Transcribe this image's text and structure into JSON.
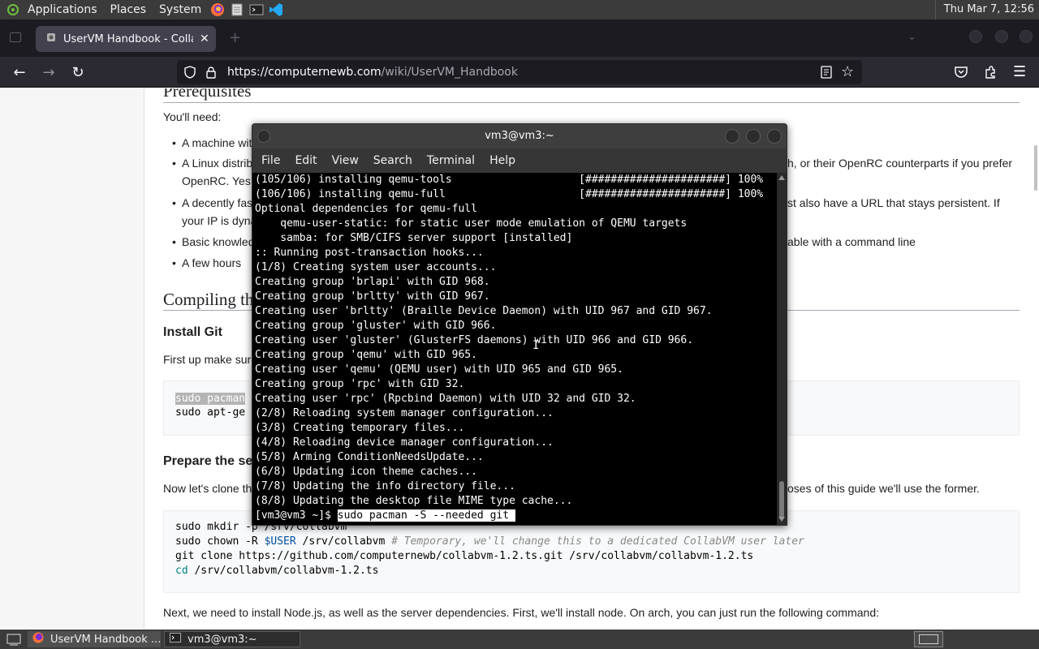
{
  "top_panel": {
    "menus": [
      "Applications",
      "Places",
      "System"
    ],
    "clock": "Thu Mar  7, 12:56"
  },
  "browser": {
    "tab_title": "UserVM Handbook - CollabVM",
    "url_host": "https://computernewb.com",
    "url_path": "/wiki/UserVM_Handbook"
  },
  "page": {
    "heading_prereq": "Prerequisites",
    "need_text": "You'll need:",
    "bullets": [
      "A machine wit",
      "A Linux distrib",
      "OpenRC. Yes,",
      "A decently fas",
      "your IP is dyna",
      "Basic knowled",
      "A few hours"
    ],
    "bullets_right": [
      "h, or their OpenRC counterparts if you prefer",
      "st also have a URL that stays persistent. If",
      "able with a command line"
    ],
    "heading_compiling": "Compiling th",
    "heading_install_git": "Install Git",
    "first_up": "First up make sur",
    "git_code": [
      "sudo pacman",
      "sudo apt-ge"
    ],
    "heading_prepare": "Prepare the se",
    "clone_text": "Now let's clone th",
    "clone_text_right": "oses of this guide we'll use the former.",
    "setup_code": [
      "sudo mkdir -p /srv/collabvm",
      "sudo chown -R ",
      "$USER",
      " /srv/collabvm ",
      "# Temporary, we'll change this to a dedicated CollabVM user later",
      "git clone https://github.com/computernewb/collabvm-1.2.ts.git /srv/collabvm/collabvm-1.2.ts",
      "cd",
      " /srv/collabvm/collabvm-1.2.ts"
    ],
    "next_text": "Next, we need to install Node.js, as well as the server dependencies. First, we'll install node. On arch, you can just run the following command:"
  },
  "terminal": {
    "title": "vm3@vm3:~",
    "menu": [
      "File",
      "Edit",
      "View",
      "Search",
      "Terminal",
      "Help"
    ],
    "lines": [
      "(105/106) installing qemu-tools                    [######################] 100%",
      "(106/106) installing qemu-full                     [######################] 100%",
      "Optional dependencies for qemu-full",
      "    qemu-user-static: for static user mode emulation of QEMU targets",
      "    samba: for SMB/CIFS server support [installed]",
      ":: Running post-transaction hooks...",
      "(1/8) Creating system user accounts...",
      "Creating group 'brlapi' with GID 968.",
      "Creating group 'brltty' with GID 967.",
      "Creating user 'brltty' (Braille Device Daemon) with UID 967 and GID 967.",
      "Creating group 'gluster' with GID 966.",
      "Creating user 'gluster' (GlusterFS daemons) with UID 966 and GID 966.",
      "Creating group 'qemu' with GID 965.",
      "Creating user 'qemu' (QEMU user) with UID 965 and GID 965.",
      "Creating group 'rpc' with GID 32.",
      "Creating user 'rpc' (Rpcbind Daemon) with UID 32 and GID 32.",
      "(2/8) Reloading system manager configuration...",
      "(3/8) Creating temporary files...",
      "(4/8) Reloading device manager configuration...",
      "(5/8) Arming ConditionNeedsUpdate...",
      "(6/8) Updating icon theme caches...",
      "(7/8) Updating the info directory file...",
      "(8/8) Updating the desktop file MIME type cache..."
    ],
    "prompt": "[vm3@vm3 ~]$ ",
    "command": "sudo pacman -S --needed git "
  },
  "taskbar": {
    "items": [
      "UserVM Handbook ...",
      "vm3@vm3:~"
    ]
  },
  "colors": {
    "panel": "#3b3b3b",
    "browser_chrome": "#2b2a33",
    "terminal_bg": "#000000"
  }
}
